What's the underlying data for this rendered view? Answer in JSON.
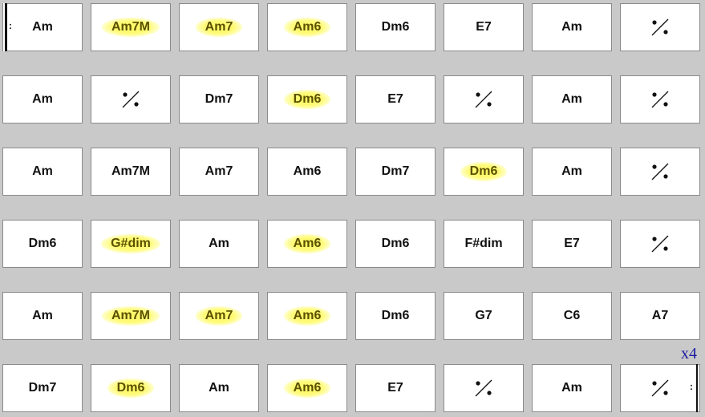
{
  "repeat_count": "x4",
  "repeat_marks": {
    "start": ":",
    "end": ":"
  },
  "colors": {
    "highlight": "#fff866",
    "count": "#1a1aa0",
    "background": "#c9c9c9"
  },
  "rows": [
    [
      {
        "chord": "Am",
        "repeat_start": true
      },
      {
        "chord": "Am7M",
        "highlight": true
      },
      {
        "chord": "Am7",
        "highlight": true
      },
      {
        "chord": "Am6",
        "highlight": true
      },
      {
        "chord": "Dm6"
      },
      {
        "chord": "E7"
      },
      {
        "chord": "Am"
      },
      {
        "symbol": "repeat-measure"
      }
    ],
    [
      {
        "chord": "Am"
      },
      {
        "symbol": "repeat-measure"
      },
      {
        "chord": "Dm7"
      },
      {
        "chord": "Dm6",
        "highlight": true
      },
      {
        "chord": "E7"
      },
      {
        "symbol": "repeat-measure"
      },
      {
        "chord": "Am"
      },
      {
        "symbol": "repeat-measure"
      }
    ],
    [
      {
        "chord": "Am"
      },
      {
        "chord": "Am7M"
      },
      {
        "chord": "Am7"
      },
      {
        "chord": "Am6"
      },
      {
        "chord": "Dm7"
      },
      {
        "chord": "Dm6",
        "highlight": true
      },
      {
        "chord": "Am"
      },
      {
        "symbol": "repeat-measure"
      }
    ],
    [
      {
        "chord": "Dm6"
      },
      {
        "chord": "G#dim",
        "highlight": true
      },
      {
        "chord": "Am"
      },
      {
        "chord": "Am6",
        "highlight": true
      },
      {
        "chord": "Dm6"
      },
      {
        "chord": "F#dim"
      },
      {
        "chord": "E7"
      },
      {
        "symbol": "repeat-measure"
      }
    ],
    [
      {
        "chord": "Am"
      },
      {
        "chord": "Am7M",
        "highlight": true
      },
      {
        "chord": "Am7",
        "highlight": true
      },
      {
        "chord": "Am6",
        "highlight": true
      },
      {
        "chord": "Dm6"
      },
      {
        "chord": "G7"
      },
      {
        "chord": "C6"
      },
      {
        "chord": "A7"
      }
    ],
    [
      {
        "chord": "Dm7"
      },
      {
        "chord": "Dm6",
        "highlight": true
      },
      {
        "chord": "Am"
      },
      {
        "chord": "Am6",
        "highlight": true
      },
      {
        "chord": "E7"
      },
      {
        "symbol": "repeat-measure"
      },
      {
        "chord": "Am"
      },
      {
        "symbol": "repeat-measure",
        "repeat_end": true
      }
    ]
  ]
}
